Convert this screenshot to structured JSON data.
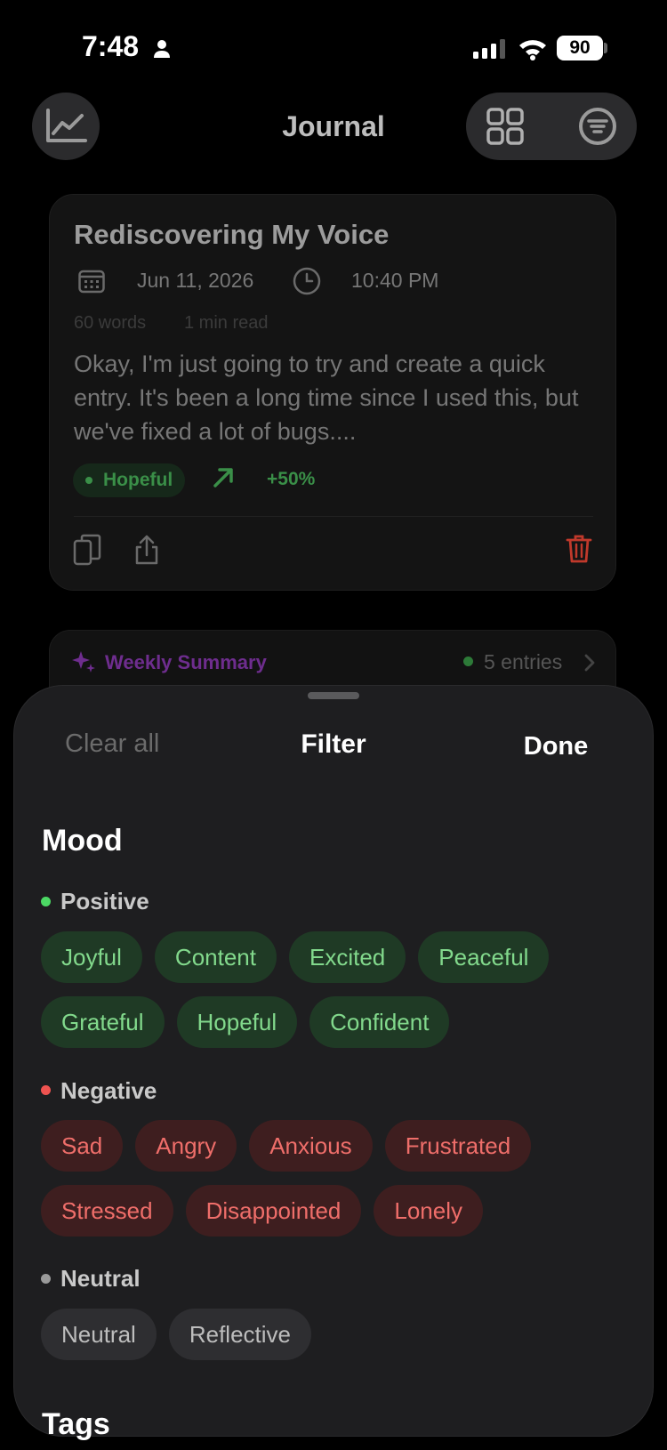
{
  "status": {
    "time": "7:48",
    "battery": "90"
  },
  "nav": {
    "title": "Journal"
  },
  "entry": {
    "title": "Rediscovering My Voice",
    "date": "Jun 11, 2026",
    "time": "10:40 PM",
    "word_count": "60 words",
    "read_time": "1 min read",
    "preview": "Okay, I'm just going to try and create a quick entry. It's been a long time since I used this, but we've fixed a lot of bugs....",
    "mood": "Hopeful",
    "trend": "+50%"
  },
  "summary": {
    "title": "Weekly Summary",
    "count": "5 entries"
  },
  "sheet": {
    "clear_all": "Clear all",
    "title": "Filter",
    "done": "Done",
    "mood_heading": "Mood",
    "tags_heading": "Tags",
    "positive": {
      "label": "Positive",
      "row1": [
        "Joyful",
        "Content",
        "Excited",
        "Peaceful"
      ],
      "row2": [
        "Grateful",
        "Hopeful",
        "Confident"
      ]
    },
    "negative": {
      "label": "Negative",
      "row1": [
        "Sad",
        "Angry",
        "Anxious",
        "Frustrated"
      ],
      "row2": [
        "Stressed",
        "Disappointed",
        "Lonely"
      ]
    },
    "neutral": {
      "label": "Neutral",
      "row1": [
        "Neutral",
        "Reflective"
      ]
    }
  },
  "colors": {
    "positive": "#4cd964",
    "negative": "#ef5350",
    "neutral": "#9a9a9a",
    "accent_purple": "#6e2d8e"
  },
  "icons": [
    "person-icon",
    "cellular-signal-icon",
    "wifi-icon",
    "chart-line-icon",
    "grid-icon",
    "filter-icon",
    "calendar-icon",
    "clock-icon",
    "trend-up-icon",
    "copy-icon",
    "share-icon",
    "trash-icon",
    "sparkle-icon",
    "chevron-right-icon"
  ]
}
